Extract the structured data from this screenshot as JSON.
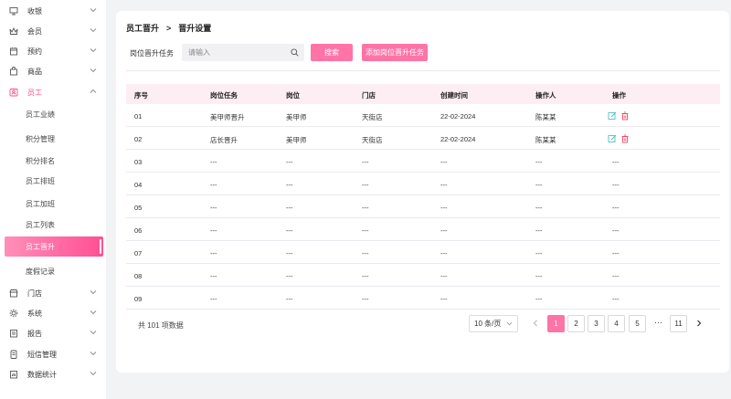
{
  "sidebar": {
    "menu": [
      {
        "label": "收银",
        "icon": "monitor-icon"
      },
      {
        "label": "会员",
        "icon": "crown-icon"
      },
      {
        "label": "预约",
        "icon": "calendar-icon"
      },
      {
        "label": "商品",
        "icon": "bag-icon"
      },
      {
        "label": "员工",
        "icon": "person-card-icon"
      },
      {
        "label": "门店",
        "icon": "store-icon"
      },
      {
        "label": "系统",
        "icon": "gear-icon"
      },
      {
        "label": "报告",
        "icon": "report-icon"
      },
      {
        "label": "短信管理",
        "icon": "sms-icon"
      },
      {
        "label": "数据统计",
        "icon": "stats-icon"
      }
    ],
    "staff_sub": [
      "员工业绩",
      "积分管理",
      "积分排名",
      "员工排班",
      "员工加班",
      "员工列表",
      "员工晋升",
      "度假记录"
    ],
    "active_sub": "员工晋升"
  },
  "breadcrumb": {
    "parent": "员工晋升",
    "separator": ">",
    "current": "晋升设置"
  },
  "filter": {
    "label": "岗位晋升任务",
    "placeholder": "请输入",
    "search_button": "搜索",
    "add_button": "添加岗位晋升任务"
  },
  "table": {
    "headers": [
      "序号",
      "岗位任务",
      "岗位",
      "门店",
      "创建时间",
      "操作人",
      "操作"
    ],
    "rows": [
      {
        "no": "01",
        "task": "美甲师晋升",
        "post": "美甲师",
        "store": "天街店",
        "created": "22-02-2024",
        "operator": "陈某某",
        "actions": true
      },
      {
        "no": "02",
        "task": "店长晋升",
        "post": "美甲师",
        "store": "天街店",
        "created": "22-02-2024",
        "operator": "陈某某",
        "actions": true
      },
      {
        "no": "03",
        "task": "---",
        "post": "---",
        "store": "---",
        "created": "---",
        "operator": "---",
        "actions": false
      },
      {
        "no": "04",
        "task": "---",
        "post": "---",
        "store": "---",
        "created": "---",
        "operator": "---",
        "actions": false
      },
      {
        "no": "05",
        "task": "---",
        "post": "---",
        "store": "---",
        "created": "---",
        "operator": "---",
        "actions": false
      },
      {
        "no": "06",
        "task": "---",
        "post": "---",
        "store": "---",
        "created": "---",
        "operator": "---",
        "actions": false
      },
      {
        "no": "07",
        "task": "---",
        "post": "---",
        "store": "---",
        "created": "---",
        "operator": "---",
        "actions": false
      },
      {
        "no": "08",
        "task": "---",
        "post": "---",
        "store": "---",
        "created": "---",
        "operator": "---",
        "actions": false
      },
      {
        "no": "09",
        "task": "---",
        "post": "---",
        "store": "---",
        "created": "---",
        "operator": "---",
        "actions": false
      }
    ]
  },
  "pagination": {
    "total_text": "共 101 项数据",
    "page_size": "10 条/页",
    "pages": [
      "1",
      "2",
      "3",
      "4",
      "5"
    ],
    "ellipsis": "···",
    "last_page": "11",
    "current": "1"
  },
  "colors": {
    "accent": "#ff74a7",
    "header_bg": "#fdeef4",
    "edit_icon": "#4fc1c9",
    "delete_icon": "#f04a6a"
  }
}
